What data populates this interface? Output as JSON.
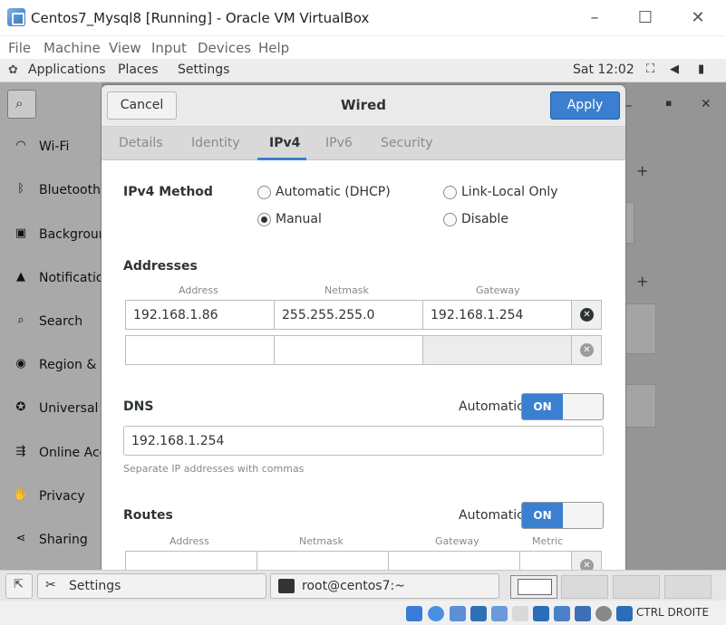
{
  "host": {
    "title": "Centos7_Mysql8 [Running] - Oracle VM VirtualBox",
    "menu": [
      "File",
      "Machine",
      "View",
      "Input",
      "Devices",
      "Help"
    ],
    "status_right": "CTRL DROITE"
  },
  "topbar": {
    "applications": "Applications",
    "places": "Places",
    "settings": "Settings",
    "clock": "Sat 12:02"
  },
  "sidebar": {
    "items": [
      {
        "icon": "wifi-icon",
        "label": "Wi-Fi",
        "glyph": "◠"
      },
      {
        "icon": "bluetooth-icon",
        "label": "Bluetooth",
        "glyph": "ᛒ"
      },
      {
        "icon": "background-icon",
        "label": "Background",
        "glyph": "▣"
      },
      {
        "icon": "bell-icon",
        "label": "Notifications",
        "glyph": "▲"
      },
      {
        "icon": "search-icon",
        "label": "Search",
        "glyph": "⌕"
      },
      {
        "icon": "region-icon",
        "label": "Region & Language",
        "glyph": "◉"
      },
      {
        "icon": "universal-access-icon",
        "label": "Universal Access",
        "glyph": "✪"
      },
      {
        "icon": "online-accounts-icon",
        "label": "Online Accounts",
        "glyph": "⇶"
      },
      {
        "icon": "privacy-icon",
        "label": "Privacy",
        "glyph": "✋"
      },
      {
        "icon": "sharing-icon",
        "label": "Sharing",
        "glyph": "⋖"
      }
    ]
  },
  "dialog": {
    "title": "Wired",
    "cancel": "Cancel",
    "apply": "Apply",
    "tabs": [
      "Details",
      "Identity",
      "IPv4",
      "IPv6",
      "Security"
    ],
    "active_tab": "IPv4",
    "method_label": "IPv4 Method",
    "methods": {
      "dhcp": "Automatic (DHCP)",
      "link_local": "Link-Local Only",
      "manual": "Manual",
      "disable": "Disable"
    },
    "selected_method": "Manual",
    "addresses": {
      "heading": "Addresses",
      "columns": [
        "Address",
        "Netmask",
        "Gateway"
      ],
      "rows": [
        {
          "address": "192.168.1.86",
          "netmask": "255.255.255.0",
          "gateway": "192.168.1.254"
        },
        {
          "address": "",
          "netmask": "",
          "gateway": ""
        }
      ]
    },
    "dns": {
      "heading": "DNS",
      "automatic_label": "Automatic",
      "switch": "ON",
      "value": "192.168.1.254",
      "hint": "Separate IP addresses with commas"
    },
    "routes": {
      "heading": "Routes",
      "automatic_label": "Automatic",
      "switch": "ON",
      "columns": [
        "Address",
        "Netmask",
        "Gateway",
        "Metric"
      ]
    }
  },
  "taskbar": {
    "settings": "Settings",
    "terminal": "root@centos7:~"
  }
}
